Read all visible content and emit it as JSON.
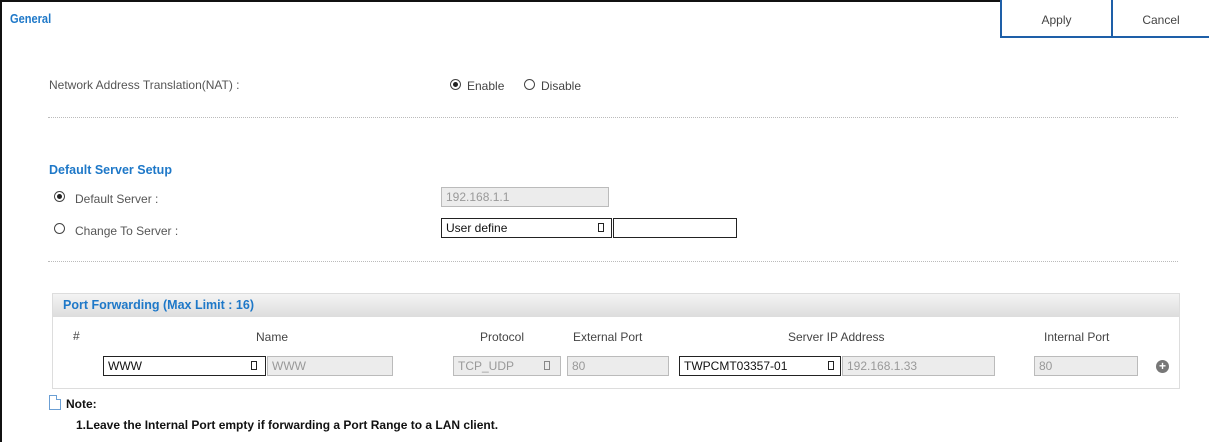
{
  "header": {
    "title": "General",
    "apply_label": "Apply",
    "cancel_label": "Cancel"
  },
  "nat": {
    "label": "Network Address Translation(NAT) :",
    "enable_label": "Enable",
    "disable_label": "Disable",
    "selected": "Enable"
  },
  "default_server": {
    "section_title": "Default Server Setup",
    "default_label": "Default Server :",
    "default_value": "192.168.1.1",
    "change_label": "Change To Server :",
    "change_select": "User define",
    "change_value": "",
    "selected": "Default Server"
  },
  "port_forwarding": {
    "title": "Port Forwarding (Max Limit : 16)",
    "columns": [
      "#",
      "Name",
      "Protocol",
      "External Port",
      "Server IP Address",
      "Internal Port"
    ],
    "row": {
      "name_select": "WWW",
      "name_value": "WWW",
      "protocol": "TCP_UDP",
      "external_port": "80",
      "server_select": "TWPCMT03357-01",
      "server_ip": "192.168.1.33",
      "internal_port": "80",
      "add_icon": "plus-icon"
    }
  },
  "note": {
    "title": "Note:",
    "line1": "1.Leave the Internal Port empty if forwarding a Port Range to a LAN client."
  }
}
